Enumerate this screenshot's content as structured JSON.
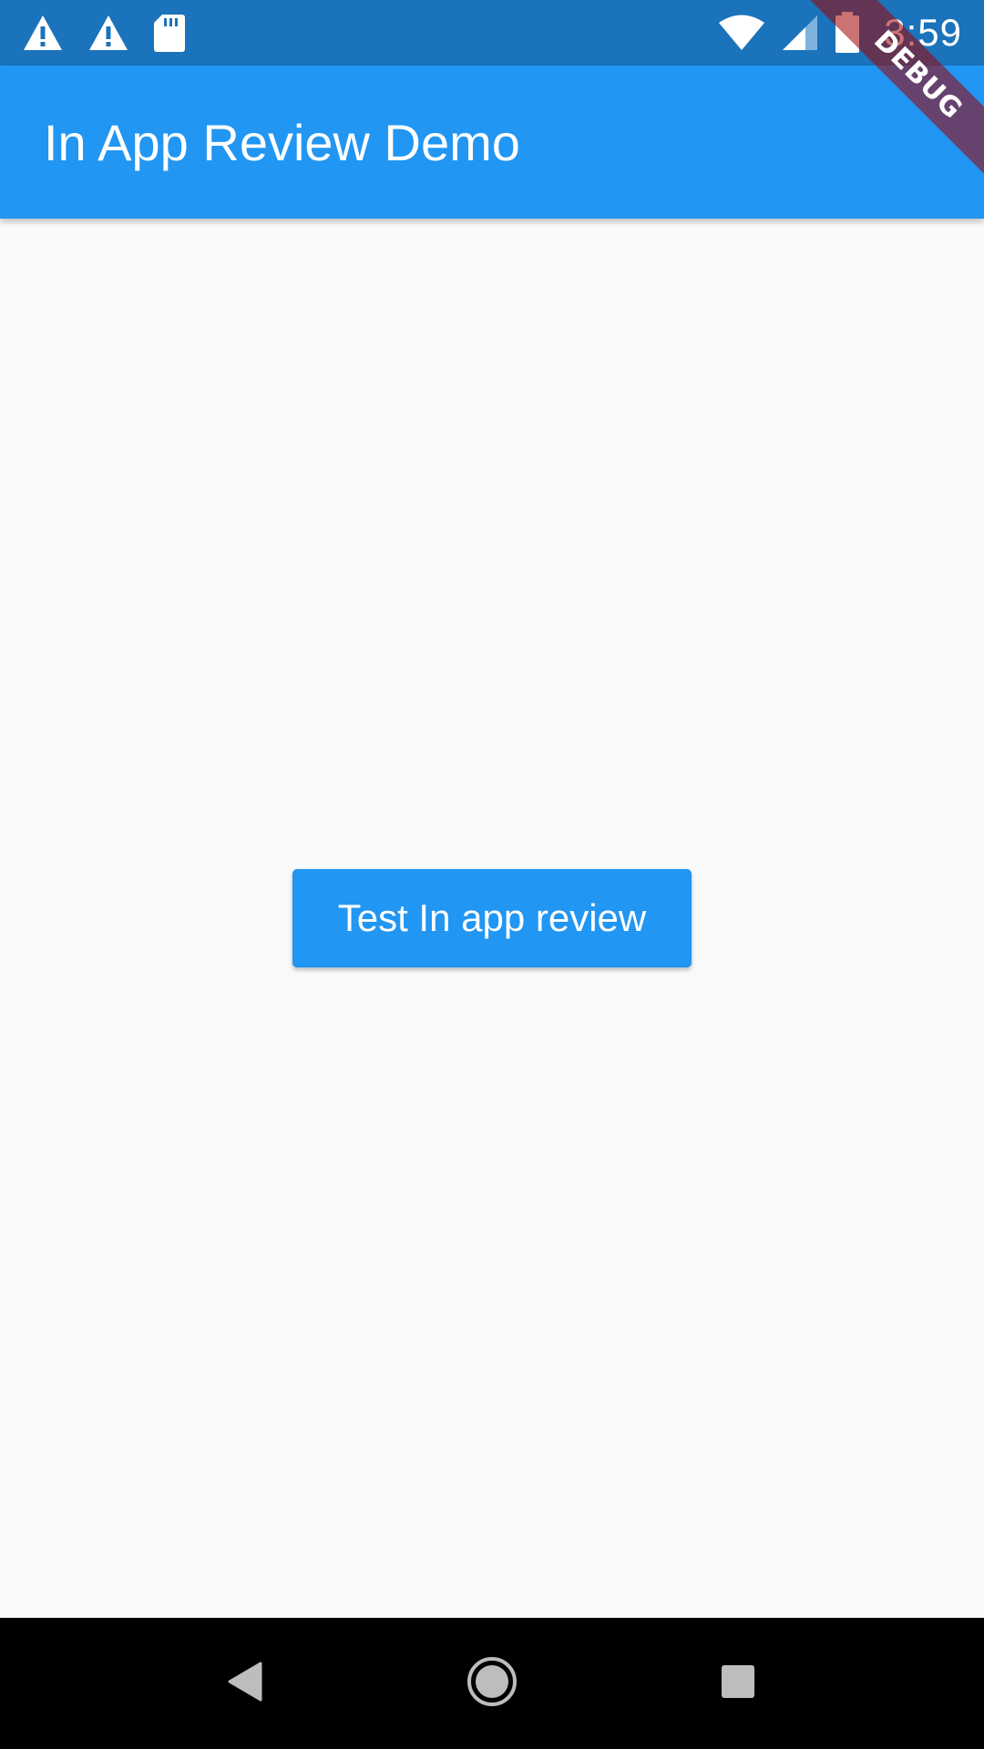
{
  "status_bar": {
    "time": "3:59",
    "left_icons": [
      "warning-icon",
      "warning-icon",
      "sd-card-icon"
    ],
    "right_icons": [
      "wifi-icon",
      "cell-signal-icon",
      "battery-icon"
    ]
  },
  "app_bar": {
    "title": "In App Review Demo"
  },
  "debug_banner": {
    "label": "DEBUG"
  },
  "main": {
    "button_label": "Test In app review"
  },
  "nav_bar": {
    "icons": [
      "back-icon",
      "home-icon",
      "recents-icon"
    ]
  },
  "colors": {
    "status_bar": "#1a73bb",
    "app_bar": "#2196f3",
    "button": "#2196f3",
    "background": "#fafafa",
    "nav_bar": "#000000",
    "debug_ribbon": "#a0003c"
  }
}
